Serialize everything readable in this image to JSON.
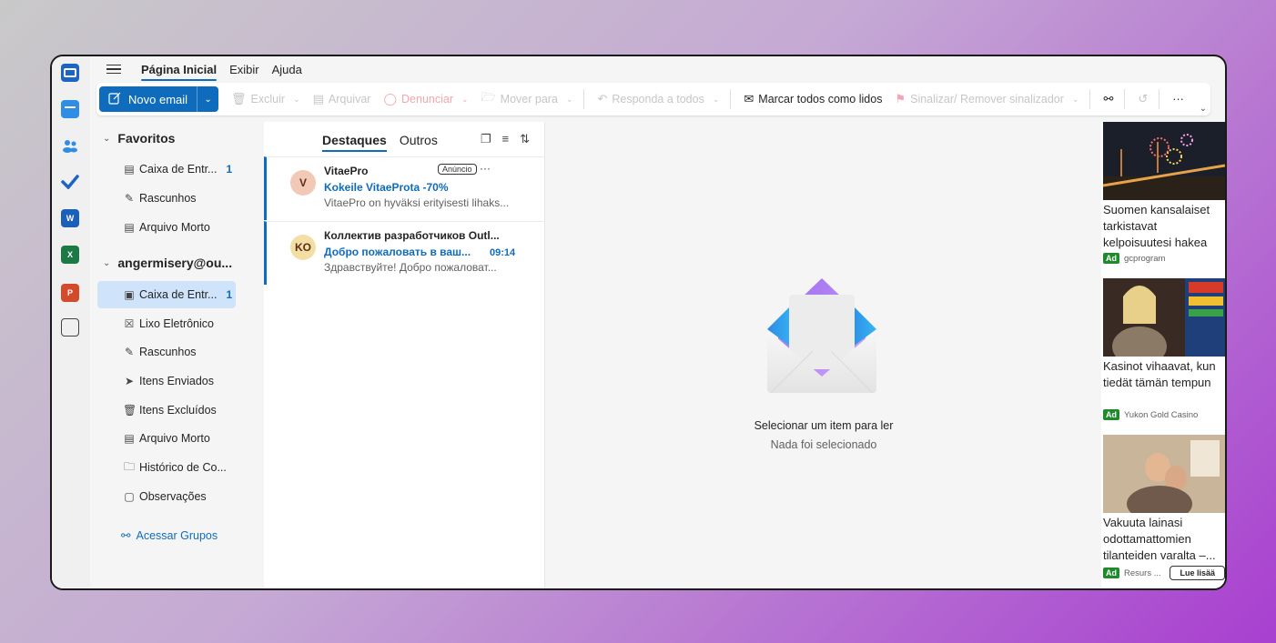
{
  "menu": {
    "tabs": [
      "Página Inicial",
      "Exibir",
      "Ajuda"
    ]
  },
  "toolbar": {
    "new_mail": "Novo email",
    "delete": "Excluir",
    "archive": "Arquivar",
    "report": "Denunciar",
    "move_to": "Mover para",
    "reply_all": "Responda a todos",
    "mark_all_read": "Marcar todos como lidos",
    "flag": "Sinalizar/ Remover sinalizador",
    "more": "···"
  },
  "folders": {
    "favorites_header": "Favoritos",
    "favorites": [
      {
        "label": "Caixa de Entr...",
        "count": "1"
      },
      {
        "label": "Rascunhos",
        "count": ""
      },
      {
        "label": "Arquivo Morto",
        "count": ""
      }
    ],
    "account_header": "angermisery@ou...",
    "account": [
      {
        "label": "Caixa de Entr...",
        "count": "1"
      },
      {
        "label": "Lixo Eletrônico",
        "count": ""
      },
      {
        "label": "Rascunhos",
        "count": ""
      },
      {
        "label": "Itens Enviados",
        "count": ""
      },
      {
        "label": "Itens Excluídos",
        "count": ""
      },
      {
        "label": "Arquivo Morto",
        "count": ""
      },
      {
        "label": "Histórico de Co...",
        "count": ""
      },
      {
        "label": "Observações",
        "count": ""
      }
    ],
    "groups": "Acessar Grupos"
  },
  "messages": {
    "tabs": [
      "Destaques",
      "Outros"
    ],
    "items": [
      {
        "avatar": "V",
        "from": "VitaePro",
        "badge": "Anúncio",
        "subject": "Kokeile VitaeProta -70%",
        "time": "",
        "preview": "VitaePro on hyväksi erityisesti lihaks..."
      },
      {
        "avatar": "KO",
        "from": "Коллектив разработчиков Outl...",
        "badge": "",
        "subject": "Добро пожаловать в ваш...",
        "time": "09:14",
        "preview": "Здравствуйте! Добро пожаловат..."
      }
    ]
  },
  "reading": {
    "title": "Selecionar um item para ler",
    "subtitle": "Nada foi selecionado"
  },
  "ads": [
    {
      "text": "Suomen kansalaiset tarkistavat kelpoisuutesi hakea",
      "source": "gcprogram",
      "badge": "Ad"
    },
    {
      "text": "Kasinot vihaavat, kun tiedät tämän tempun",
      "source": "Yukon Gold Casino",
      "badge": "Ad"
    },
    {
      "text": "Vakuuta lainasi odottamattomien tilanteiden varalta –...",
      "source": "Resurs ...",
      "badge": "Ad",
      "cta": "Lue lisää"
    }
  ],
  "apps": {
    "word": "W",
    "excel": "X",
    "ppt": "P"
  },
  "colors": {
    "accent": "#0f6cbd",
    "selected": "#cfe4fa",
    "ad_badge": "#1f8a2c"
  }
}
